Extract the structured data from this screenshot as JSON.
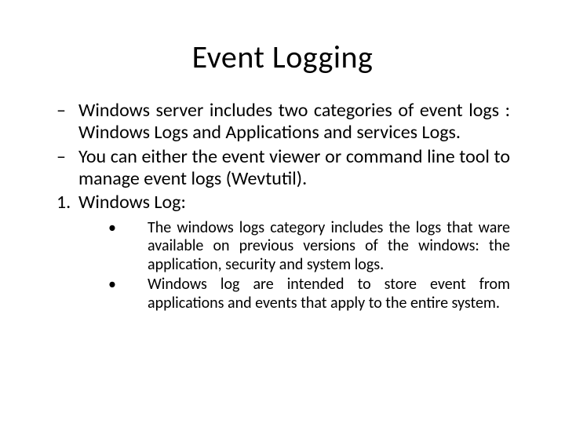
{
  "title": "Event Logging",
  "bullets": [
    "Windows server includes two categories of event logs : Windows Logs and Applications and services Logs.",
    "You can either the event viewer or command line tool to manage event logs (Wevtutil)."
  ],
  "numbered": {
    "marker": "1.",
    "text": "Windows Log:"
  },
  "subbullets": [
    "The windows logs category includes the logs that ware available on previous versions of the windows: the application, security and system logs.",
    "Windows log are intended to store event from applications and events that apply to the entire system."
  ],
  "markers": {
    "dash": "–",
    "dot": "•"
  }
}
